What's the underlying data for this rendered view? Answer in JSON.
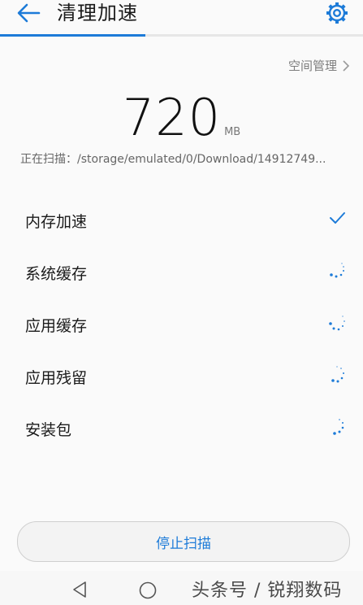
{
  "header": {
    "back_icon": "back-arrow-icon",
    "title": "清理加速",
    "settings_icon": "gear-icon",
    "scan_progress": 0.4
  },
  "space_management": {
    "label": "空间管理",
    "icon": "chevron-right-icon"
  },
  "summary": {
    "size_value": "720",
    "size_unit": "MB",
    "scan_path": "正在扫描：/storage/emulated/0/Download/14912749..."
  },
  "scan_items": [
    {
      "label": "内存加速",
      "status": "done",
      "status_icon": "check-icon"
    },
    {
      "label": "系统缓存",
      "status": "scanning",
      "status_icon": "loading-spinner-icon"
    },
    {
      "label": "应用缓存",
      "status": "scanning",
      "status_icon": "loading-spinner-icon"
    },
    {
      "label": "应用残留",
      "status": "scanning",
      "status_icon": "loading-spinner-icon"
    },
    {
      "label": "安装包",
      "status": "scanning",
      "status_icon": "loading-spinner-icon"
    }
  ],
  "stop_button": {
    "label": "停止扫描"
  },
  "navigation": {
    "back_icon": "nav-back-triangle-icon",
    "home_icon": "nav-home-circle-icon"
  },
  "watermark": "头条号 / 锐翔数码",
  "colors": {
    "accent": "#1d7bd8",
    "background": "#fafafa",
    "secondary_text": "#7d7d7d"
  }
}
